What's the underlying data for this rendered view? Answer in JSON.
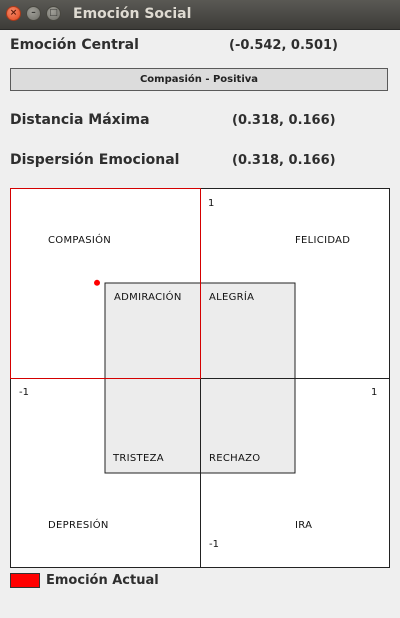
{
  "window": {
    "title": "Emoción Social"
  },
  "central": {
    "label": "Emoción Central",
    "value": "(-0.542, 0.501)"
  },
  "status_bar": {
    "text": "Compasión - Positiva"
  },
  "max_distance": {
    "label": "Distancia Máxima",
    "value": "(0.318, 0.166)"
  },
  "dispersion": {
    "label": "Dispersión Emocional",
    "value": "(0.318, 0.166)"
  },
  "plot": {
    "quadrants": {
      "compasion": "COMPASIÓN",
      "felicidad": "FELICIDAD",
      "admiracion": "ADMIRACIÓN",
      "alegria": "ALEGRÍA",
      "tristeza": "TRISTEZA",
      "rechazo": "RECHAZO",
      "depresion": "DEPRESIÓN",
      "ira": "IRA"
    },
    "ticks": {
      "y_max": "1",
      "x_min": "-1",
      "x_max": "1",
      "y_min": "-1"
    },
    "current_point": {
      "x": -0.542,
      "y": 0.501
    },
    "marker_color": "#ff0000",
    "highlight_color": "#d40000"
  },
  "legend": {
    "label": "Emoción Actual",
    "color": "#ff0000"
  }
}
